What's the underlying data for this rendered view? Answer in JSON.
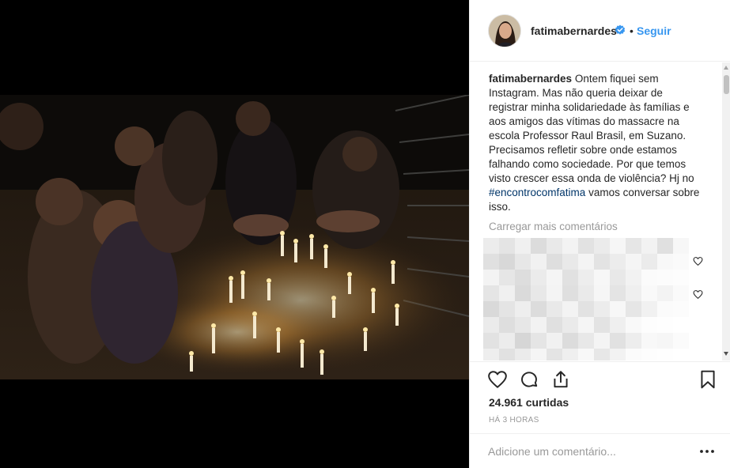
{
  "post": {
    "media_alt": "",
    "header": {
      "username": "fatimabernardes",
      "separator": "•",
      "follow_label": "Seguir"
    },
    "caption": {
      "username": "fatimabernardes",
      "text_before_tag": "Ontem fiquei sem Instagram. Mas não queria deixar de registrar minha solidariedade às famílias e aos amigos das vítimas do massacre na escola Professor Raul Brasil, em Suzano. Precisamos refletir sobre onde estamos falhando como sociedade. Por que temos visto crescer essa onda de violência? Hj no ",
      "hashtag": "#encontrocomfatima",
      "text_after_tag": " vamos conversar sobre isso."
    },
    "load_more_label": "Carregar mais comentários",
    "likes_label": "24.961 curtidas",
    "time_label": "HÁ 3 HORAS",
    "add_comment_placeholder": "Adicione um comentário...",
    "options_label": "•••"
  },
  "icons": {
    "verified": "verified-badge-icon",
    "like": "heart-icon",
    "comment": "comment-bubble-icon",
    "share": "share-upload-icon",
    "save": "bookmark-icon",
    "comment_like": "heart-outline-icon"
  },
  "colors": {
    "link": "#3897f0",
    "hashtag": "#003569",
    "muted": "#999999",
    "text": "#262626",
    "divider": "#efefef"
  }
}
